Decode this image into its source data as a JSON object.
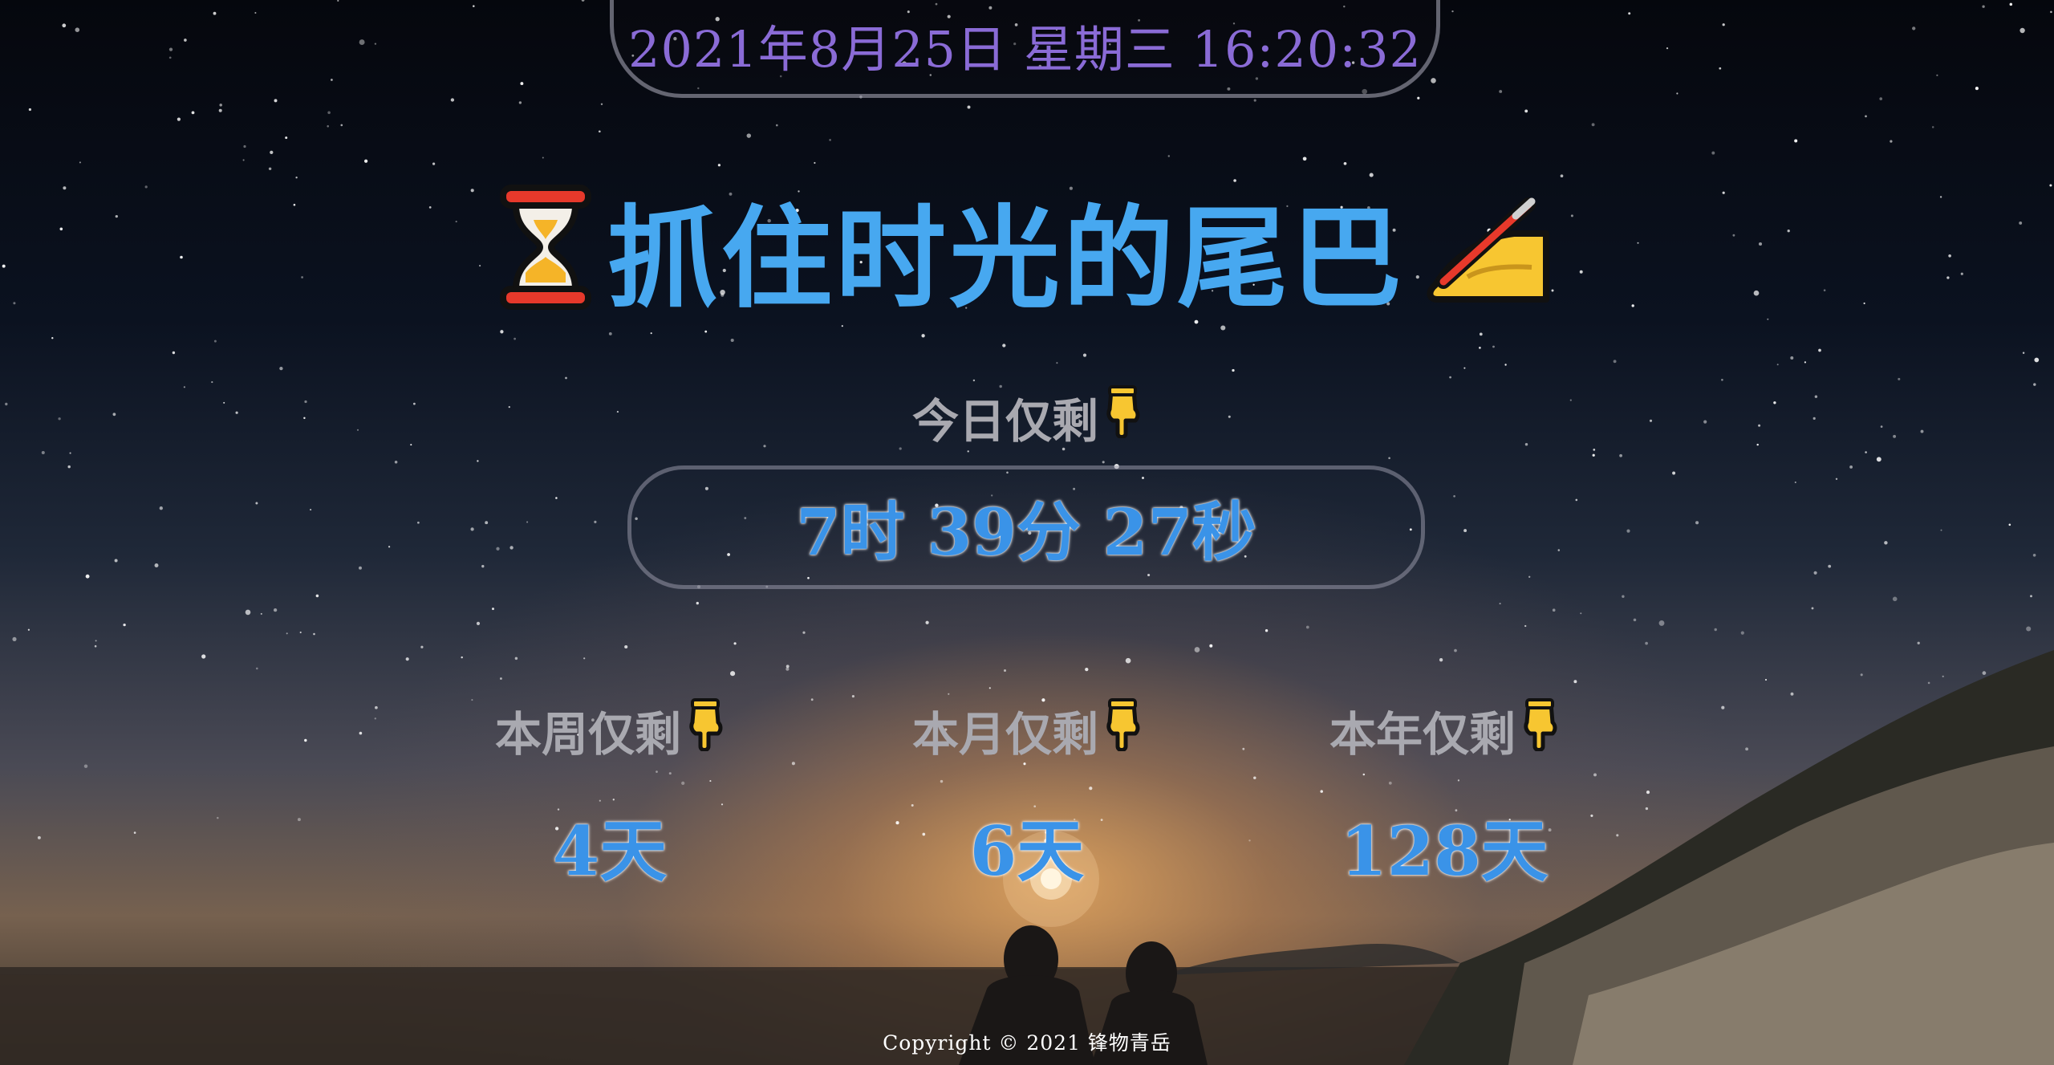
{
  "clock": {
    "text": "2021年8月25日 星期三 16:20:32"
  },
  "headline": {
    "text": "抓住时光的尾巴",
    "left_icon": "hourglass-icon",
    "right_icon": "writing-hand-icon"
  },
  "today": {
    "label": "今日仅剩",
    "icon": "pointing-down-icon",
    "value": "7时 39分 27秒"
  },
  "stats": [
    {
      "label": "本周仅剩",
      "icon": "pointing-down-icon",
      "value": "4天"
    },
    {
      "label": "本月仅剩",
      "icon": "pointing-down-icon",
      "value": "6天"
    },
    {
      "label": "本年仅剩",
      "icon": "pointing-down-icon",
      "value": "128天"
    }
  ],
  "footer": {
    "copyright": "Copyright © 2021 锋物青岳"
  },
  "colors": {
    "headline": "#47a8f0",
    "clock": "#8a6bd6",
    "value": "#3a93e8",
    "label": "#a9a9b0"
  }
}
